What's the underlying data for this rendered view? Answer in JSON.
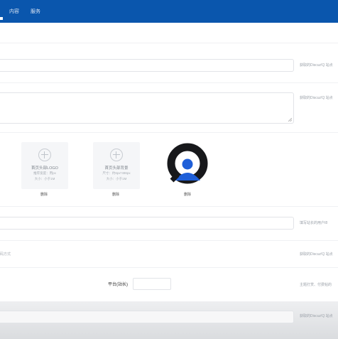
{
  "topnav": {
    "items": [
      {
        "label": "内容"
      },
      {
        "label": "服务"
      }
    ]
  },
  "form": {
    "rows": [
      {
        "hint": "获取的Discuz!Q 站点"
      },
      {
        "hint": "获取的Discuz!Q 站点"
      },
      {
        "hint": "填写站长的用户I8"
      },
      {
        "hint": "获取的Discuz!Q 站点"
      },
      {
        "hint": "主题打赏、付费帖的"
      },
      {
        "hint": "获取的Discuz!Q 站点"
      }
    ],
    "left_fragment": "码方式",
    "platform_label": "平台(站长)"
  },
  "uploads": {
    "logo": {
      "title": "首页头部LOGO",
      "line1": "推荐宽度：用px",
      "line2": "大小：小于1M",
      "delete": "删除"
    },
    "background": {
      "title": "首页头部背景",
      "line1": "尺寸：约6px*496px",
      "line2": "大小：小于1M",
      "delete": "删除"
    },
    "image": {
      "delete": "删除"
    }
  },
  "colors": {
    "topbar": "#0a56ad",
    "logo_dark": "#17181b",
    "logo_blue": "#1f5fd8"
  }
}
